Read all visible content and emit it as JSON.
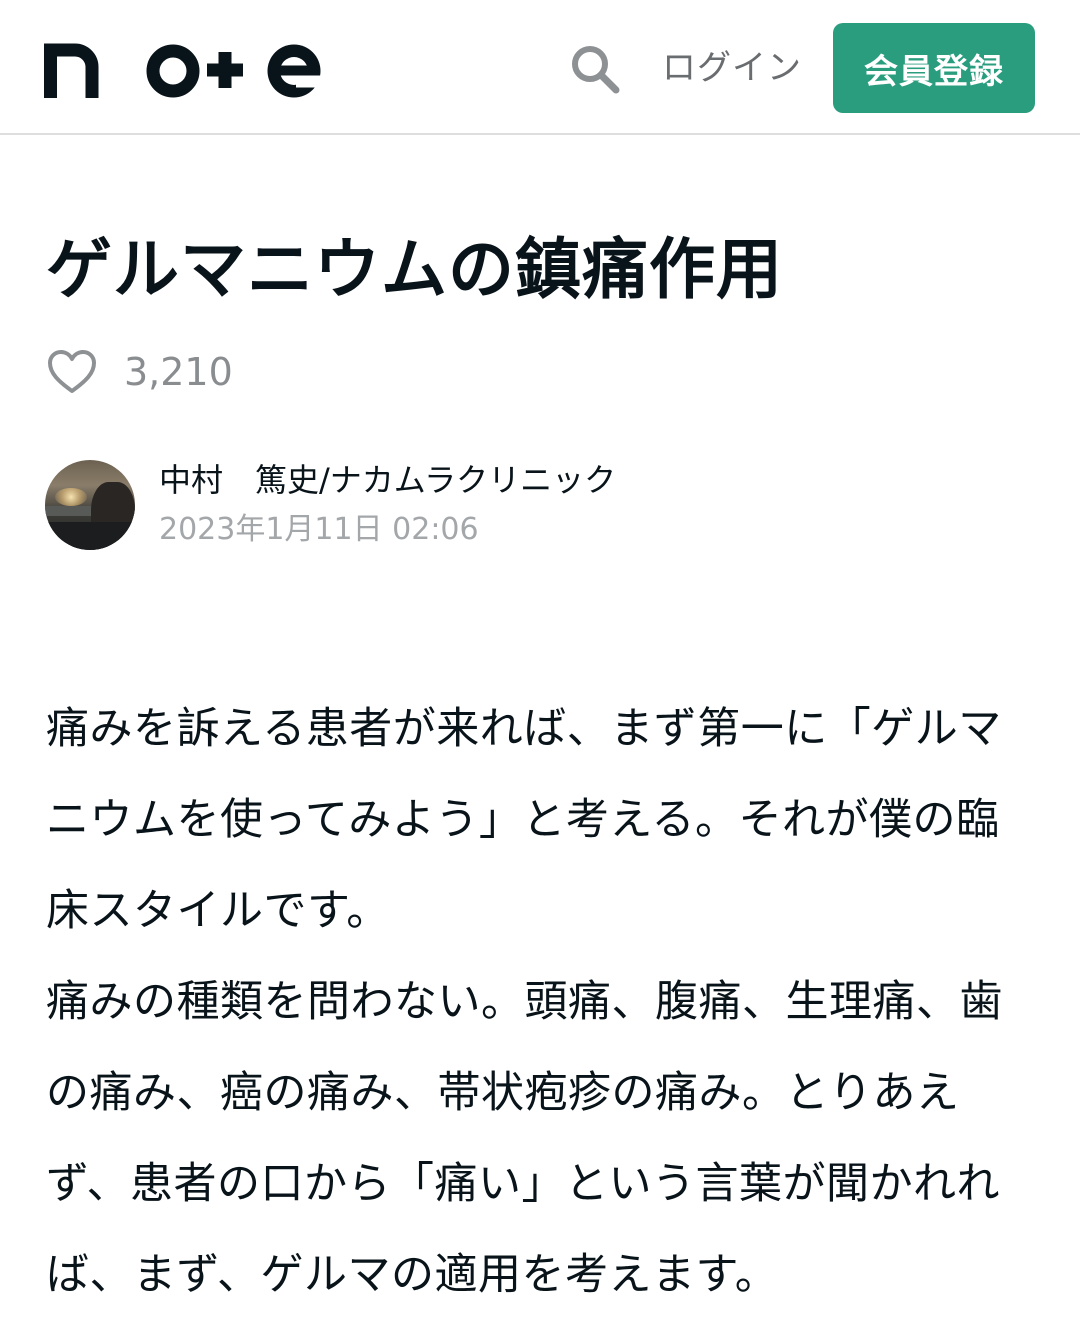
{
  "header": {
    "logo_text": "note",
    "search_icon": "search-icon",
    "login_label": "ログイン",
    "signup_label": "会員登録",
    "colors": {
      "accent": "#2a9d7f",
      "logo": "#08131a",
      "muted": "#6a6d70"
    }
  },
  "article": {
    "title": "ゲルマニウムの鎮痛作用",
    "like_icon": "heart-outline-icon",
    "like_count": "3,210",
    "author": {
      "name": "中村　篤史/ナカムラクリニック",
      "date": "2023年1月11日 02:06"
    },
    "paragraphs": [
      "痛みを訴える患者が来れば、まず第一に「ゲルマニウムを使ってみよう」と考える。それが僕の臨床スタイルです。",
      "痛みの種類を問わない。頭痛、腹痛、生理痛、歯の痛み、癌の痛み、帯状疱疹の痛み。とりあえず、患者の口から「痛い」という言葉が聞かれれば、まず、ゲルマの適用を考えます。"
    ]
  }
}
